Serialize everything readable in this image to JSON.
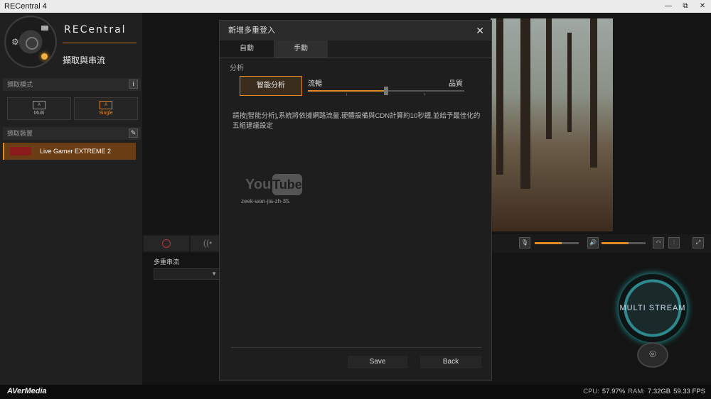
{
  "window": {
    "title": "RECentral 4",
    "min": "—",
    "restore": "⧉",
    "close": "✕"
  },
  "sidebar": {
    "brand": "RECentral",
    "mode_title": "擷取與串流",
    "capture_mode_label": "擷取模式",
    "info_icon": "i",
    "modes": [
      {
        "label": "Multi",
        "icon": "A"
      },
      {
        "label": "Single",
        "icon": "A",
        "active": true
      }
    ],
    "devices_label": "擷取裝置",
    "edit_icon": "✎",
    "device": "Live Gamer EXTREME 2"
  },
  "footer": {
    "logo": "AVerMedia",
    "cpu_label": "CPU:",
    "cpu": "57.97%",
    "ram_label": "RAM:",
    "ram": "7.32GB",
    "fps": "59.33 FPS"
  },
  "main": {
    "multistream_label": "多重串流",
    "multistream_button": "MULTI STREAM",
    "volume_levels": {
      "mic": 0.62,
      "speaker": 0.62
    },
    "camera_icon": "⌾"
  },
  "dialog": {
    "title": "新增多重登入",
    "close": "✕",
    "tabs": [
      {
        "label": "自動",
        "active": true
      },
      {
        "label": "手動"
      }
    ],
    "section": "分析",
    "analyze_button": "智能分析",
    "slider_left": "流暢",
    "slider_right": "品質",
    "slider_value": 0.5,
    "description": "請按[智能分析],系統將依據網路流量,硬體設備與CDN計算約10秒鐘,並給予最佳化的五組建議設定",
    "watermark_you": "You",
    "watermark_tube": "Tube",
    "watermark_sub": "zeek-wan-jia-zh-35.",
    "save": "Save",
    "back": "Back"
  }
}
